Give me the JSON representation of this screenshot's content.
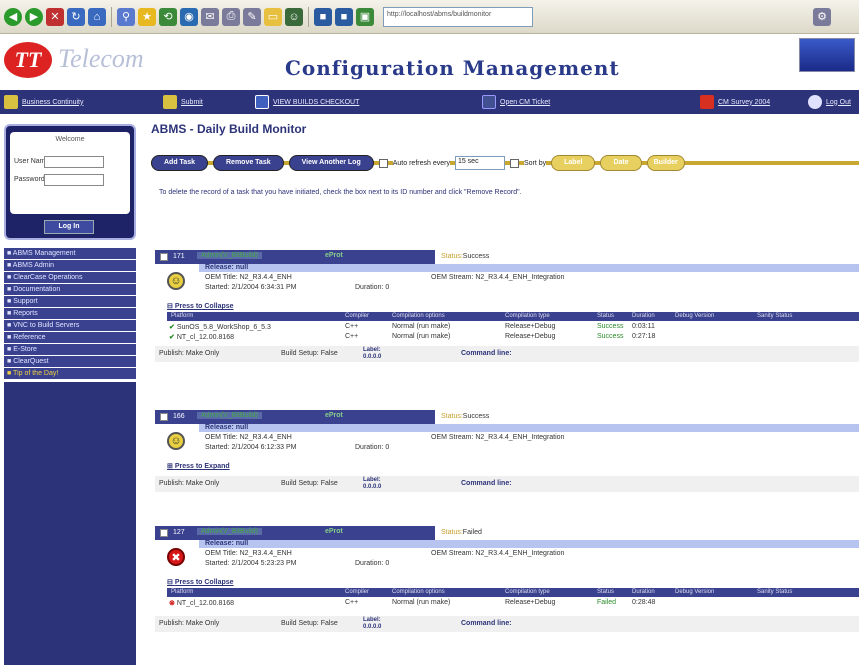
{
  "address_bar": "http://localhost/abms/buildmonitor",
  "header": {
    "logo_mark": "TT",
    "logo_text": "Telecom",
    "title": "Configuration Management"
  },
  "nav": {
    "items": [
      {
        "label": "Business Continuity",
        "icon": "home-icon",
        "color": "#d8c040"
      },
      {
        "label": "Submit",
        "icon": "submit-icon",
        "color": "#d8c040"
      },
      {
        "label": "VIEW BUILDS CHECKOUT",
        "icon": "view-icon",
        "color": "#4060c0"
      },
      {
        "label": "Open CM Ticket",
        "icon": "ticket-icon",
        "color": "#405090"
      },
      {
        "label": "CM Survey 2004",
        "icon": "survey-icon",
        "color": "#d83020"
      },
      {
        "label": "Log Out",
        "icon": "logout-icon",
        "color": "#e0e0ff"
      }
    ]
  },
  "login": {
    "welcome": "Welcome",
    "username_label": "User Name",
    "password_label": "Password",
    "button": "Log In"
  },
  "sidebar_menu": [
    "ABMS Management",
    "ABMS Admin",
    "ClearCase Operations",
    "Documentation",
    "Support",
    "Reports",
    "VNC to Build Servers",
    "Reference",
    "E-Store",
    "ClearQuest",
    "Tip of the Day!"
  ],
  "page": {
    "title": "ABMS - Daily Build Monitor",
    "buttons": {
      "add": "Add Task",
      "remove": "Remove Task",
      "view_log": "View Another Log"
    },
    "auto_refresh_label": "Auto refresh every",
    "refresh_value": "15 sec",
    "sort_label": "Sort by",
    "sort_options": [
      "Label",
      "Date",
      "Builder"
    ],
    "instructions": "To delete the record of a task that you have initiated, check the box next to its ID number and click \"Remove Record\"."
  },
  "table_headers": [
    "Platform",
    "Compiler",
    "Compilation options",
    "Compilation type",
    "Status",
    "Duration",
    "Debug Version",
    "Sanity Status"
  ],
  "tasks": [
    {
      "id": "171",
      "user": "Admin(V_BitBuild)",
      "tool": "eProt",
      "status_label": "Status:",
      "status": "Success",
      "release": "Release: null",
      "oem_title": "OEM Title: N2_R3.4.4_ENH",
      "oem_stream": "OEM Stream: N2_R3.4.4_ENH_Integration",
      "started": "Started: 2/1/2004 6:34:31 PM",
      "duration": "Duration: 0",
      "toggle": "Press to Collapse",
      "rows": [
        {
          "platform": "SunOS_5.8_WorkShop_6_5.3",
          "compiler": "C++",
          "options": "Normal (run make)",
          "type": "Release+Debug",
          "status": "Success",
          "duration": "0:03:11"
        },
        {
          "platform": "NT_cl_12.00.8168",
          "compiler": "C++",
          "options": "Normal (run make)",
          "type": "Release+Debug",
          "status": "Success",
          "duration": "0:27:18"
        }
      ],
      "publish": "Publish: Make Only",
      "build_setup": "Build Setup: False",
      "label_title": "Label:",
      "label_value": "0.0.0.0",
      "command_line": "Command line:"
    },
    {
      "id": "166",
      "user": "Admin(V_BitBuild)",
      "tool": "eProt",
      "status_label": "Status:",
      "status": "Success",
      "release": "Release: null",
      "oem_title": "OEM Title: N2_R3.4.4_ENH",
      "oem_stream": "OEM Stream: N2_R3.4.4_ENH_Integration",
      "started": "Started: 2/1/2004 6:12:33 PM",
      "duration": "Duration: 0",
      "toggle": "Press to Expand",
      "rows": [],
      "publish": "Publish: Make Only",
      "build_setup": "Build Setup: False",
      "label_title": "Label:",
      "label_value": "0.0.0.0",
      "command_line": "Command line:"
    },
    {
      "id": "127",
      "user": "Admin(V_BitBuild)",
      "tool": "eProt",
      "status_label": "Status:",
      "status": "Failed",
      "release": "Release: null",
      "oem_title": "OEM Title: N2_R3.4.4_ENH",
      "oem_stream": "OEM Stream: N2_R3.4.4_ENH_Integration",
      "started": "Started: 2/1/2004 5:23:23 PM",
      "duration": "Duration: 0",
      "toggle": "Press to Collapse",
      "rows": [
        {
          "platform": "NT_cl_12.00.8168",
          "compiler": "C++",
          "options": "Normal (run make)",
          "type": "Release+Debug",
          "status": "Failed",
          "duration": "0:28:48"
        }
      ],
      "publish": "Publish: Make Only",
      "build_setup": "Build Setup: False",
      "label_title": "Label:",
      "label_value": "0.0.0.0",
      "command_line": "Command line:"
    }
  ]
}
